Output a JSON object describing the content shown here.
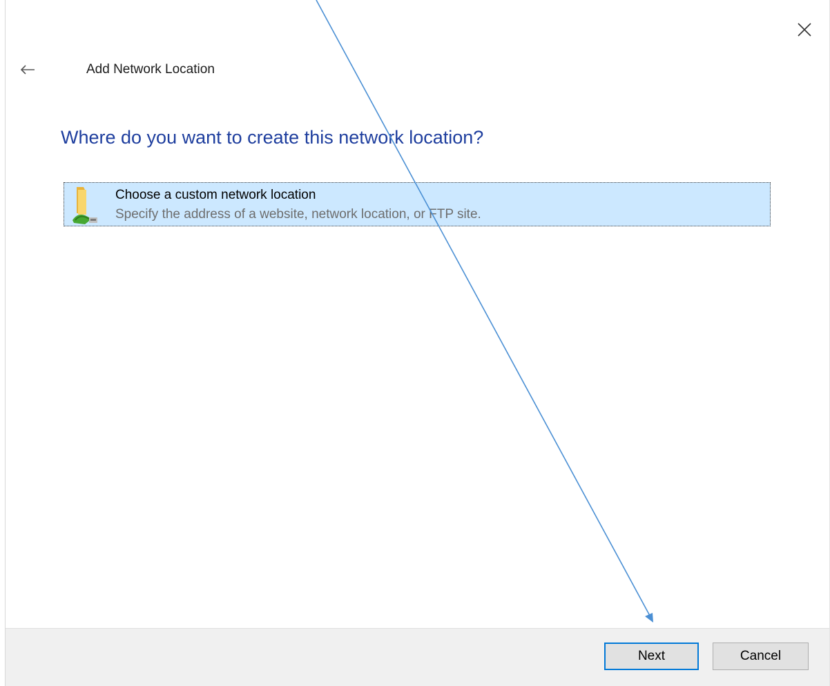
{
  "window": {
    "title": "Add Network Location",
    "close_icon": "close-icon",
    "back_icon": "back-arrow-icon"
  },
  "page": {
    "heading": "Where do you want to create this network location?"
  },
  "options": [
    {
      "title": "Choose a custom network location",
      "description": "Specify the address of a website, network location, or FTP site.",
      "icon": "network-folder-icon",
      "selected": true
    }
  ],
  "footer": {
    "next_label": "Next",
    "cancel_label": "Cancel"
  },
  "colors": {
    "heading": "#1e3e9e",
    "selection_bg": "#cce8ff",
    "footer_bg": "#f0f0f0",
    "default_button_border": "#0078d7",
    "annotation_arrow": "#4a8fd4"
  },
  "annotation": {
    "type": "arrow",
    "target": "next-button"
  }
}
